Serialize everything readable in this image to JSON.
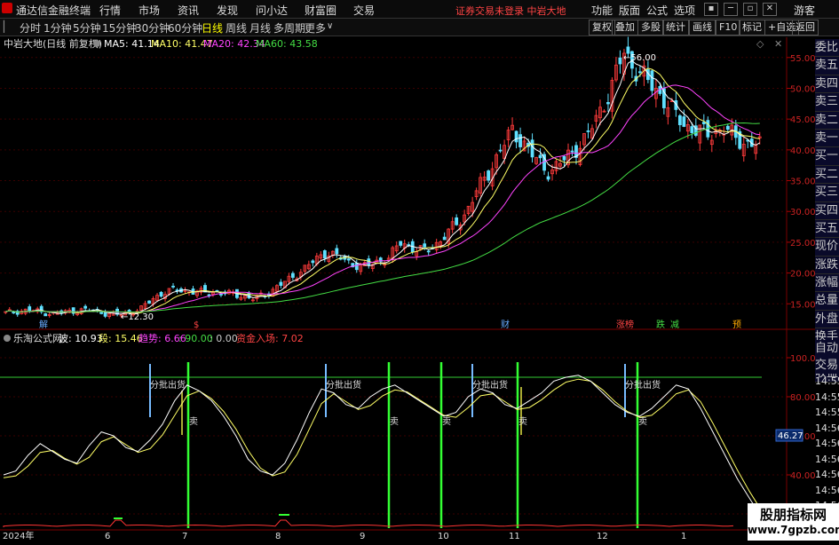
{
  "app": {
    "title": "通达信金融终端",
    "warning": "证券交易未登录  中岩大地",
    "guest": "游客"
  },
  "menu": [
    "行情",
    "市场",
    "资讯",
    "发现",
    "问小达",
    "财富圈",
    "交易"
  ],
  "right_menu": [
    "功能",
    "版面",
    "公式",
    "选项"
  ],
  "window_controls": [
    "▪",
    "─",
    "▫",
    "✕"
  ],
  "periods": [
    "分时",
    "1分钟",
    "5分钟",
    "15分钟",
    "30分钟",
    "60分钟",
    "日线",
    "周线",
    "月线",
    "多周期",
    "更多"
  ],
  "active_period": "日线",
  "toolbar": [
    "复权",
    "叠加",
    "多股",
    "统计",
    "画线",
    "F10",
    "标记",
    "+自选",
    "返回"
  ],
  "side_labels": [
    "委比",
    "卖五",
    "卖四",
    "卖三",
    "卖二",
    "卖一",
    "买一",
    "买二",
    "买三",
    "买四",
    "买五",
    "现价",
    "涨跌",
    "涨幅",
    "总量",
    "外盘",
    "换手",
    "净资",
    "收益"
  ],
  "side2_labels": [
    "自动",
    "交易"
  ],
  "side2_times": [
    "14:55",
    "14:55",
    "14:55",
    "14:56",
    "14:56",
    "14:56",
    "14:56",
    "14:56",
    "14:56",
    "14:56",
    "14:56"
  ],
  "main_header": {
    "name": "中岩大地(日线 前复权)",
    "ma5": "MA5: 41.14",
    "ma10": "MA10: 41.47",
    "ma20": "MA20: 42.34",
    "ma60": "MA60: 43.58"
  },
  "sub_header": {
    "name": "乐淘公式网",
    "bo": "波: 10.93",
    "duan": "段: 15.46",
    "trend": "趋势: 6.66",
    "v1": ": 90.00",
    "v2": ": 0.00",
    "fund": "资金入场: 7.02"
  },
  "marks": {
    "high": "56.00",
    "low": "12.30",
    "jie": "解",
    "s": "$",
    "cai": "财",
    "zhangting": "涨榜",
    "die": "跌",
    "jian": "减",
    "yu": "预",
    "cursor_value": "46.27"
  },
  "sell_labels": {
    "fenpi": "分批出货",
    "mai": "卖"
  },
  "watermark": {
    "line1": "股朋指标网",
    "line2": "www.7gpzb.com"
  },
  "colors": {
    "up": "#ff3b3b",
    "down": "#5fe0ff",
    "ma5": "#ffffff",
    "ma10": "#ffff66",
    "ma20": "#ff44ff",
    "ma60": "#44dd44",
    "signal": "#33ff33",
    "sell": "#77bbff"
  },
  "chart_data": [
    {
      "type": "candlestick",
      "title": "中岩大地(日线 前复权)",
      "ylim": [
        11,
        58
      ],
      "y_ticks": [
        15.0,
        20.0,
        25.0,
        30.0,
        35.0,
        40.0,
        45.0,
        50.0,
        55.0
      ],
      "series_ma": [
        {
          "name": "MA5",
          "last": 41.14
        },
        {
          "name": "MA10",
          "last": 41.47
        },
        {
          "name": "MA20",
          "last": 42.34
        },
        {
          "name": "MA60",
          "last": 43.58
        }
      ],
      "close_path": [
        13.5,
        13.8,
        14.0,
        13.6,
        13.4,
        13.7,
        14.0,
        13.9,
        13.5,
        13.2,
        13.6,
        14.2,
        16.0,
        17.0,
        17.3,
        17.0,
        16.8,
        17.0,
        16.6,
        16.4,
        15.8,
        16.5,
        17.8,
        19.0,
        20.5,
        22.0,
        23.5,
        22.5,
        21.5,
        21.0,
        21.8,
        22.5,
        25.0,
        24.0,
        23.5,
        25.0,
        27.0,
        29.0,
        33.0,
        36.0,
        40.0,
        43.0,
        41.0,
        38.0,
        36.5,
        38.0,
        40.0,
        42.0,
        46.0,
        50.0,
        56.0,
        53.0,
        51.0,
        49.0,
        46.0,
        44.0,
        43.0,
        42.5,
        43.5,
        42.0,
        41.0,
        40.8
      ],
      "high": 56.0,
      "low": 12.3
    },
    {
      "type": "line",
      "title": "乐淘公式网",
      "ylim": [
        15,
        105
      ],
      "y_ticks": [
        20.0,
        40.0,
        60.0,
        80.0,
        100.0
      ],
      "series": [
        {
          "name": "波",
          "last": 10.93
        },
        {
          "name": "段",
          "last": 15.46
        },
        {
          "name": "趋势",
          "last": 6.66
        }
      ],
      "wave_path": [
        40,
        42,
        50,
        56,
        52,
        48,
        46,
        55,
        62,
        60,
        54,
        52,
        58,
        66,
        78,
        86,
        83,
        78,
        70,
        60,
        48,
        42,
        40,
        46,
        58,
        72,
        84,
        82,
        76,
        74,
        80,
        84,
        86,
        82,
        78,
        74,
        70,
        72,
        80,
        84,
        82,
        76,
        74,
        78,
        82,
        88,
        90,
        91,
        88,
        82,
        76,
        72,
        70,
        74,
        80,
        86,
        84,
        74,
        62,
        50,
        38,
        28,
        18
      ],
      "reference_line": 90.0
    }
  ]
}
